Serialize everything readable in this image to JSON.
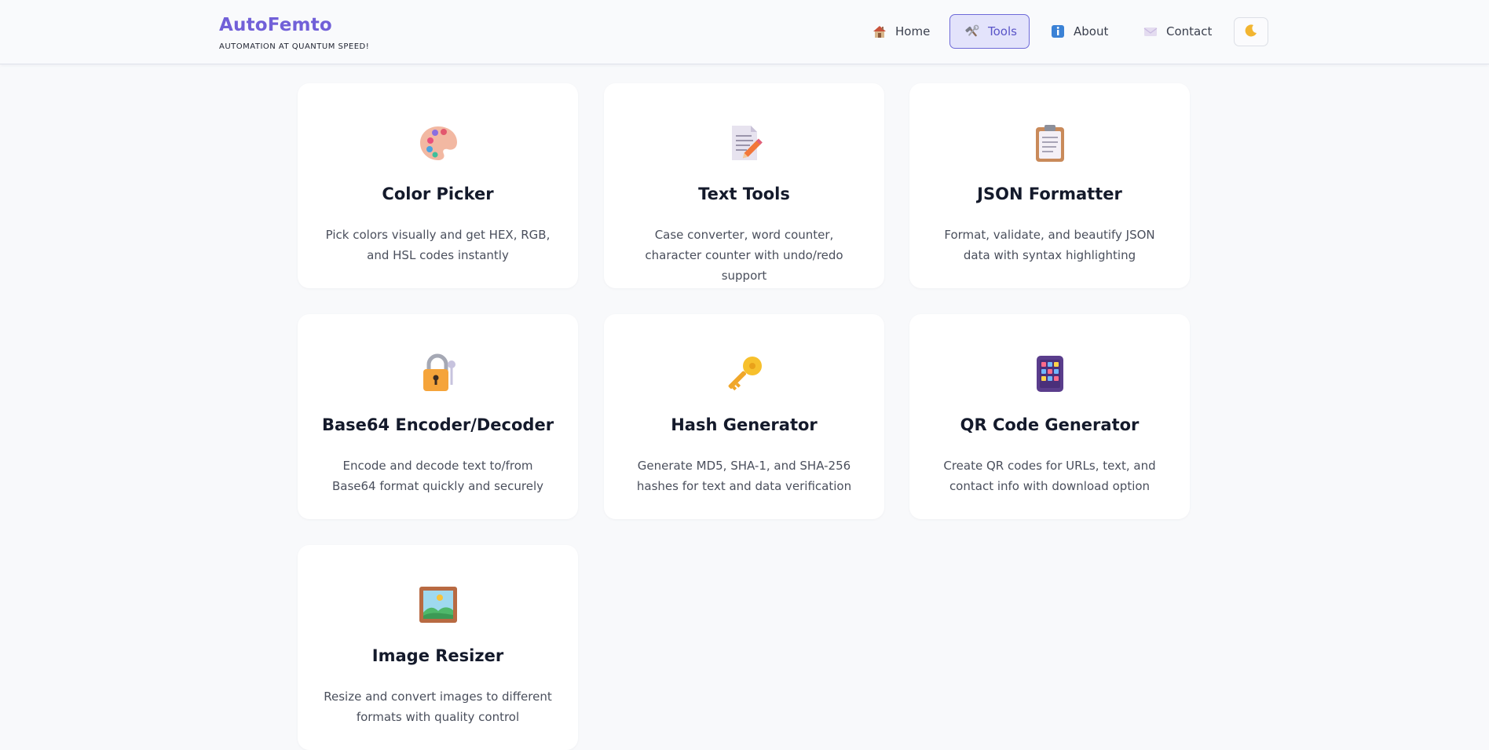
{
  "header": {
    "brand_name": "AutoFemto",
    "tagline": "AUTOMATION AT QUANTUM SPEED!",
    "nav": [
      {
        "label": "Home",
        "icon": "house-icon"
      },
      {
        "label": "Tools",
        "icon": "hammer-wrench-icon",
        "active": true
      },
      {
        "label": "About",
        "icon": "info-icon"
      },
      {
        "label": "Contact",
        "icon": "envelope-icon"
      }
    ],
    "theme_toggle_icon": "moon-icon"
  },
  "tools": [
    {
      "title": "Color Picker",
      "description": "Pick colors visually and get HEX, RGB, and HSL codes instantly",
      "icon": "palette-icon"
    },
    {
      "title": "Text Tools",
      "description": "Case converter, word counter, character counter with undo/redo support",
      "icon": "memo-pencil-icon"
    },
    {
      "title": "JSON Formatter",
      "description": "Format, validate, and beautify JSON data with syntax highlighting",
      "icon": "clipboard-icon"
    },
    {
      "title": "Base64 Encoder/Decoder",
      "description": "Encode and decode text to/from Base64 format quickly and securely",
      "icon": "lock-key-icon"
    },
    {
      "title": "Hash Generator",
      "description": "Generate MD5, SHA-1, and SHA-256 hashes for text and data verification",
      "icon": "key-icon"
    },
    {
      "title": "QR Code Generator",
      "description": "Create QR codes for URLs, text, and contact info with download option",
      "icon": "keypad-icon"
    },
    {
      "title": "Image Resizer",
      "description": "Resize and convert images to different formats with quality control",
      "icon": "framed-picture-icon"
    }
  ],
  "colors": {
    "brand": "#7160d8",
    "active_nav_bg": "#e3e3fb",
    "active_nav_border": "#6e6ad8",
    "page_bg": "#f8f9fb",
    "card_bg": "#ffffff"
  }
}
